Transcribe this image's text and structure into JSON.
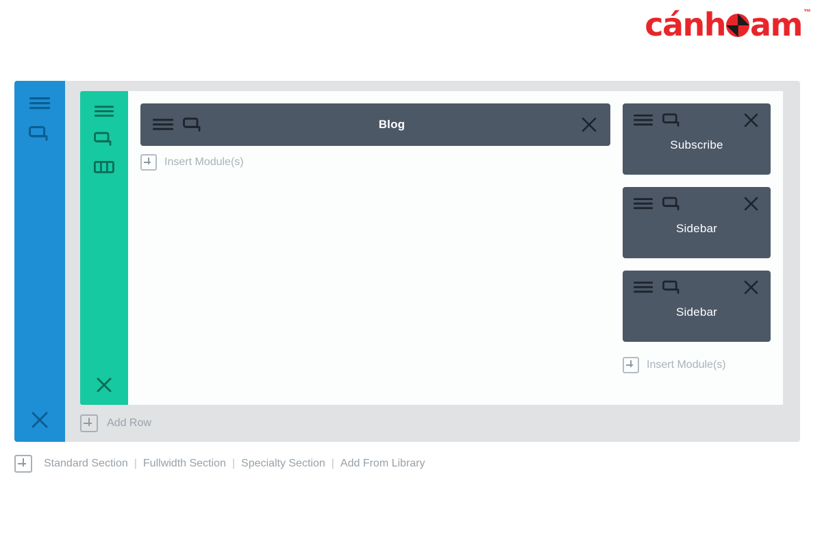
{
  "brand": {
    "text_before": "cánh",
    "text_after": "am",
    "trademark": "™",
    "color": "#e8262a",
    "pie_dark": "#1b1b1b"
  },
  "builder": {
    "section": {
      "color": "#1e8fd5",
      "icons": [
        "hamburger-icon",
        "duplicate-icon"
      ],
      "close_icon": "close-icon"
    },
    "row": {
      "color": "#16c9a0",
      "icons": [
        "hamburger-icon",
        "duplicate-icon",
        "columns-icon"
      ],
      "close_icon": "close-icon"
    },
    "module_color": "#4c5866",
    "columns": [
      {
        "name": "main-column",
        "modules": [
          {
            "title": "Blog",
            "layout": "wide"
          }
        ],
        "insert_label": "Insert Module(s)"
      },
      {
        "name": "side-column",
        "modules": [
          {
            "title": "Subscribe",
            "layout": "block"
          },
          {
            "title": "Sidebar",
            "layout": "block"
          },
          {
            "title": "Sidebar",
            "layout": "block"
          }
        ],
        "insert_label": "Insert Module(s)"
      }
    ],
    "add_row_label": "Add Row"
  },
  "section_actions": {
    "items": [
      {
        "label": "Standard Section"
      },
      {
        "label": "Fullwidth Section"
      },
      {
        "label": "Specialty Section"
      },
      {
        "label": "Add From Library"
      }
    ],
    "separator": "|"
  }
}
